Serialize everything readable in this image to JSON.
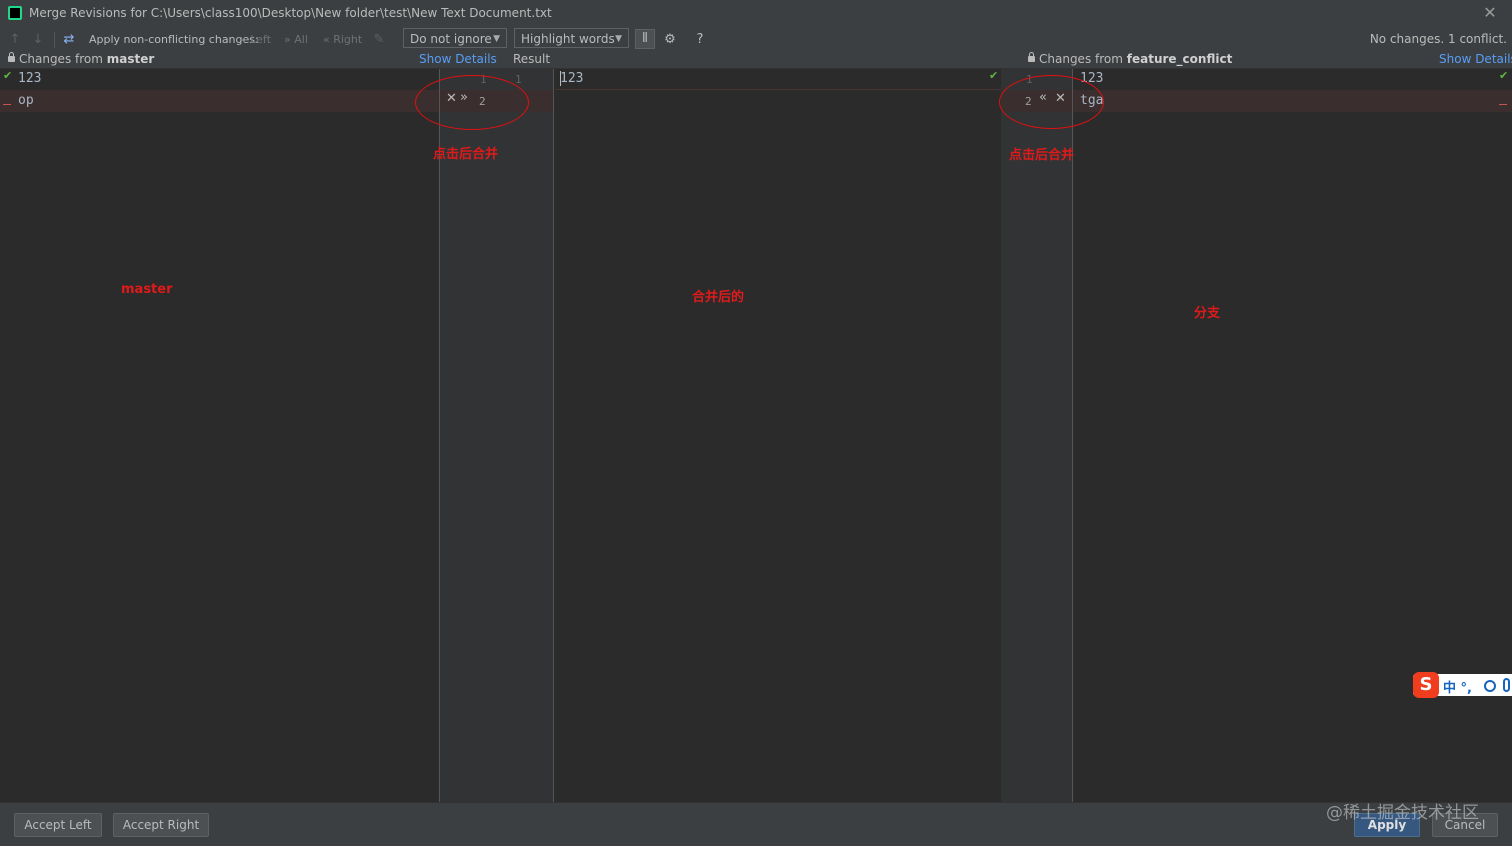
{
  "window": {
    "title": "Merge Revisions for C:\\Users\\class100\\Desktop\\New folder\\test\\New Text Document.txt",
    "close_label": "✕"
  },
  "toolbar": {
    "apply_label": "Apply non-conflicting changes:",
    "left_label": "Left",
    "all_label": "All",
    "right_label": "Right",
    "ignore_dropdown": "Do not ignore",
    "highlight_dropdown": "Highlight words",
    "help_label": "?",
    "status": "No changes. 1 conflict."
  },
  "header": {
    "left_prefix": "Changes from ",
    "left_branch": "master",
    "left_show_details": "Show Details",
    "center_title": "Result",
    "right_prefix": "Changes from ",
    "right_branch": "feature_conflict",
    "right_show_details": "Show Details"
  },
  "left_pane": {
    "lines": [
      "123",
      "op"
    ]
  },
  "left_gutter": {
    "line1": "1",
    "line2": "2",
    "result_line1": "1"
  },
  "center_pane": {
    "lines": [
      "123"
    ]
  },
  "right_gutter": {
    "line1": "1",
    "line2": "2"
  },
  "right_pane": {
    "lines": [
      "123",
      "tga"
    ]
  },
  "annotations": {
    "left_circle_note": "点击后合并",
    "right_circle_note": "点击后合并",
    "left_label": "master",
    "center_label": "合并后的",
    "right_label": "分支"
  },
  "ime": {
    "logo": "S",
    "text": "中 °,"
  },
  "buttons": {
    "accept_left": "Accept Left",
    "accept_right": "Accept Right",
    "apply": "Apply",
    "cancel": "Cancel"
  },
  "watermark": "@稀土掘金技术社区",
  "colors": {
    "accent_link": "#589df6",
    "annotation_red": "#e01a1a",
    "primary_button": "#365880"
  }
}
